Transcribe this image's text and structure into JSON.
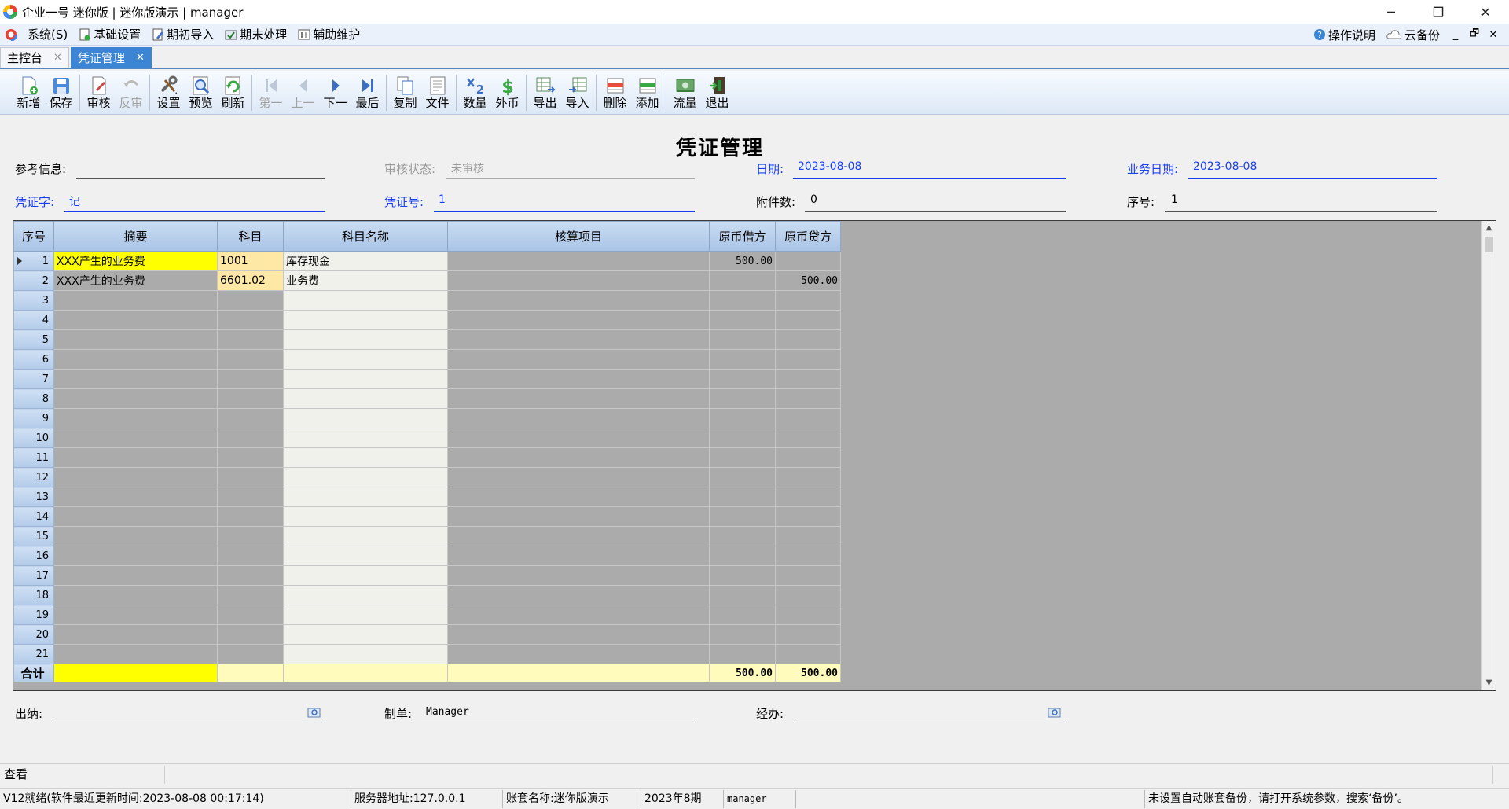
{
  "window": {
    "title": "企业一号 迷你版 | 迷你版演示 | manager",
    "minimize": "─",
    "restore": "❐",
    "close": "✕"
  },
  "menubar": {
    "items": [
      "系统(S)",
      "基础设置",
      "期初导入",
      "期末处理",
      "辅助维护"
    ],
    "help": "操作说明",
    "backup": "云备份",
    "mdi_min": "_",
    "mdi_restore": "🗗",
    "mdi_close": "✕"
  },
  "tabs": [
    {
      "label": "主控台",
      "active": false
    },
    {
      "label": "凭证管理",
      "active": true
    }
  ],
  "toolbar": {
    "buttons": [
      {
        "label": "新增",
        "icon": "new-doc-icon",
        "disabled": false
      },
      {
        "label": "保存",
        "icon": "save-icon",
        "disabled": false
      },
      {
        "label": "审核",
        "icon": "audit-icon",
        "disabled": false
      },
      {
        "label": "反审",
        "icon": "undo-icon",
        "disabled": true
      },
      {
        "label": "设置",
        "icon": "tools-icon",
        "disabled": false
      },
      {
        "label": "预览",
        "icon": "preview-icon",
        "disabled": false
      },
      {
        "label": "刷新",
        "icon": "refresh-icon",
        "disabled": false
      },
      {
        "label": "第一",
        "icon": "first-icon",
        "disabled": true
      },
      {
        "label": "上一",
        "icon": "prev-icon",
        "disabled": true
      },
      {
        "label": "下一",
        "icon": "next-icon",
        "disabled": false
      },
      {
        "label": "最后",
        "icon": "last-icon",
        "disabled": false
      },
      {
        "label": "复制",
        "icon": "copy-icon",
        "disabled": false
      },
      {
        "label": "文件",
        "icon": "file-icon",
        "disabled": false
      },
      {
        "label": "数量",
        "icon": "quantity-icon",
        "disabled": false
      },
      {
        "label": "外币",
        "icon": "currency-icon",
        "disabled": false
      },
      {
        "label": "导出",
        "icon": "export-icon",
        "disabled": false
      },
      {
        "label": "导入",
        "icon": "import-icon",
        "disabled": false
      },
      {
        "label": "删除",
        "icon": "delete-row-icon",
        "disabled": false
      },
      {
        "label": "添加",
        "icon": "add-row-icon",
        "disabled": false
      },
      {
        "label": "流量",
        "icon": "cashflow-icon",
        "disabled": false
      },
      {
        "label": "退出",
        "icon": "exit-icon",
        "disabled": false
      }
    ]
  },
  "form": {
    "title": "凭证管理",
    "reference_label": "参考信息:",
    "reference_value": "",
    "audit_status_label": "审核状态:",
    "audit_status_value": "未审核",
    "date_label": "日期:",
    "date_value": "2023-08-08",
    "biz_date_label": "业务日期:",
    "biz_date_value": "2023-08-08",
    "voucher_word_label": "凭证字:",
    "voucher_word_value": "记",
    "voucher_no_label": "凭证号:",
    "voucher_no_value": "1",
    "attachments_label": "附件数:",
    "attachments_value": "0",
    "seq_label": "序号:",
    "seq_value": "1"
  },
  "grid": {
    "headers": [
      "序号",
      "摘要",
      "科目",
      "科目名称",
      "核算项目",
      "原币借方",
      "原币贷方"
    ],
    "rows": [
      {
        "no": "1",
        "summary": "XXX产生的业务费",
        "code": "1001",
        "name": "库存现金",
        "item": "",
        "debit": "500.00",
        "credit": ""
      },
      {
        "no": "2",
        "summary": "XXX产生的业务费",
        "code": "6601.02",
        "name": "业务费",
        "item": "",
        "debit": "",
        "credit": "500.00"
      },
      {
        "no": "3"
      },
      {
        "no": "4"
      },
      {
        "no": "5"
      },
      {
        "no": "6"
      },
      {
        "no": "7"
      },
      {
        "no": "8"
      },
      {
        "no": "9"
      },
      {
        "no": "10"
      },
      {
        "no": "11"
      },
      {
        "no": "12"
      },
      {
        "no": "13"
      },
      {
        "no": "14"
      },
      {
        "no": "15"
      },
      {
        "no": "16"
      },
      {
        "no": "17"
      },
      {
        "no": "18"
      },
      {
        "no": "19"
      },
      {
        "no": "20"
      },
      {
        "no": "21"
      }
    ],
    "total_label": "合计",
    "total_debit": "500.00",
    "total_credit": "500.00"
  },
  "footer_fields": {
    "cashier_label": "出纳:",
    "cashier_value": "",
    "maker_label": "制单:",
    "maker_value": "Manager",
    "handler_label": "经办:",
    "handler_value": ""
  },
  "status": {
    "mode": "查看",
    "version": "V12就绪(软件最近更新时间:2023-08-08 00:17:14)",
    "server": "服务器地址:127.0.0.1",
    "account": "账套名称:迷你版演示",
    "period": "2023年8期",
    "user": "manager",
    "backup_hint": "未设置自动账套备份，请打开系统参数，搜索‘备份’。"
  }
}
